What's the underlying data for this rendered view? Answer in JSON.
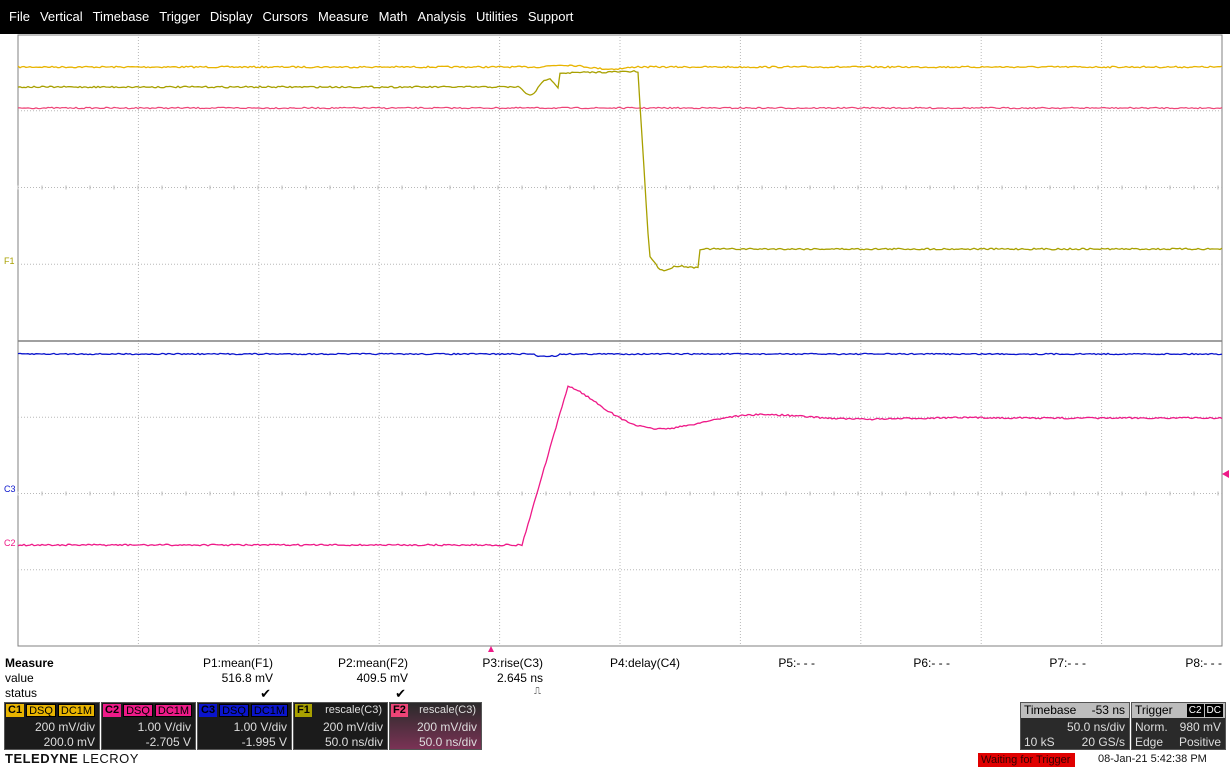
{
  "menu": [
    "File",
    "Vertical",
    "Timebase",
    "Trigger",
    "Display",
    "Cursors",
    "Measure",
    "Math",
    "Analysis",
    "Utilities",
    "Support"
  ],
  "colors": {
    "c1": "#e8b400",
    "c2": "#ee1a88",
    "c3": "#0a14cc",
    "f1": "#a8a000",
    "f2": "#ee4477",
    "grid": "#b8b8b8",
    "divider": "#808080"
  },
  "axis_markers": {
    "upper": "F1",
    "c3": "C3",
    "c2": "C2"
  },
  "measure": {
    "label_measure": "Measure",
    "label_value": "value",
    "label_status": "status",
    "params": [
      {
        "name": "P1:mean(F1)",
        "value": "516.8 mV",
        "status": "check"
      },
      {
        "name": "P2:mean(F2)",
        "value": "409.5 mV",
        "status": "check"
      },
      {
        "name": "P3:rise(C3)",
        "value": "2.645 ns",
        "status": "pulse"
      },
      {
        "name": "P4:delay(C4)",
        "value": "",
        "status": ""
      },
      {
        "name": "P5:- - -",
        "value": "",
        "status": ""
      },
      {
        "name": "P6:- - -",
        "value": "",
        "status": ""
      },
      {
        "name": "P7:- - -",
        "value": "",
        "status": ""
      },
      {
        "name": "P8:- - -",
        "value": "",
        "status": ""
      }
    ]
  },
  "channels": [
    {
      "name": "C1",
      "badges": [
        "DSQ",
        "DC1M"
      ],
      "line1": "200 mV/div",
      "line2": "200.0 mV"
    },
    {
      "name": "C2",
      "badges": [
        "DSQ",
        "DC1M"
      ],
      "line1": "1.00 V/div",
      "line2": "-2.705 V"
    },
    {
      "name": "C3",
      "badges": [
        "DSQ",
        "DC1M"
      ],
      "line1": "1.00 V/div",
      "line2": "-1.995 V"
    },
    {
      "name": "F1",
      "badges": [
        "rescale(C3)"
      ],
      "line1": "200 mV/div",
      "line2": "50.0 ns/div"
    },
    {
      "name": "F2",
      "badges": [
        "rescale(C3)"
      ],
      "line1": "200 mV/div",
      "line2": "50.0 ns/div"
    }
  ],
  "timebase": {
    "label": "Timebase",
    "delay": "-53 ns",
    "per_div": "50.0 ns/div",
    "samples": "10 kS",
    "rate": "20 GS/s"
  },
  "trigger": {
    "label": "Trigger",
    "source": "C2",
    "coupling": "DC",
    "mode": "Norm.",
    "level": "980 mV",
    "type": "Edge",
    "slope": "Positive"
  },
  "footer": {
    "brand_bold": "TELEDYNE",
    "brand_light": "LECROY",
    "status": "Waiting for Trigger",
    "datetime": "08-Jan-21 5:42:38 PM"
  }
}
